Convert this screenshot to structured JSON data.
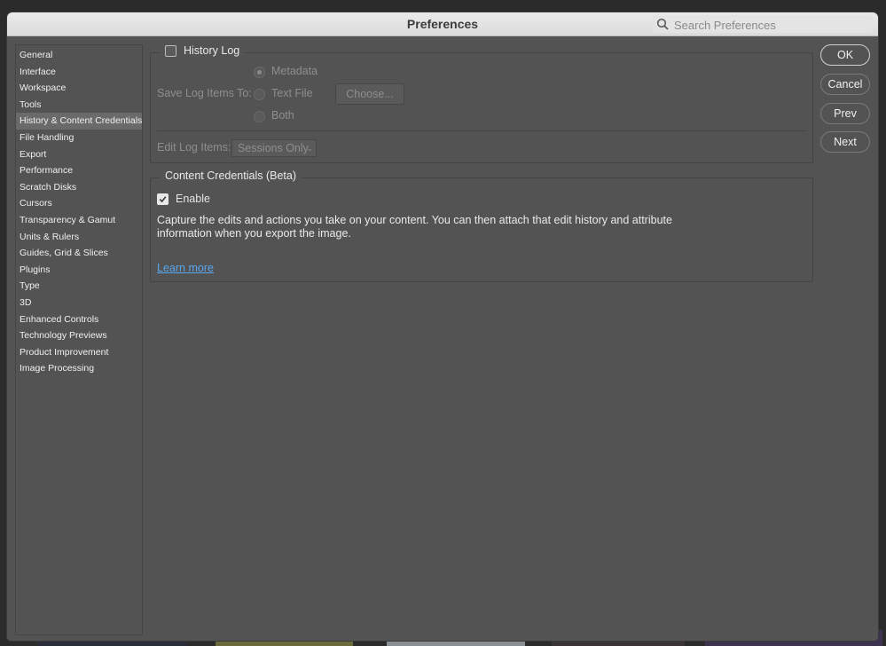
{
  "dialog": {
    "title": "Preferences",
    "search_placeholder": "Search Preferences"
  },
  "sidebar": {
    "items": [
      "General",
      "Interface",
      "Workspace",
      "Tools",
      "History & Content Credentials",
      "File Handling",
      "Export",
      "Performance",
      "Scratch Disks",
      "Cursors",
      "Transparency & Gamut",
      "Units & Rulers",
      "Guides, Grid & Slices",
      "Plugins",
      "Type",
      "3D",
      "Enhanced Controls",
      "Technology Previews",
      "Product Improvement",
      "Image Processing"
    ],
    "selected_index": 4
  },
  "history_log": {
    "label": "History Log",
    "checked": false,
    "save_label": "Save Log Items To:",
    "options": [
      "Metadata",
      "Text File",
      "Both"
    ],
    "selected_option": 0,
    "choose_label": "Choose...",
    "edit_label": "Edit Log Items:",
    "edit_value": "Sessions Only"
  },
  "content_credentials": {
    "title": "Content Credentials (Beta)",
    "enable_label": "Enable",
    "enable_checked": true,
    "description": "Capture the edits and actions you take on your content. You can then attach that edit history and attribute information when you export the image.",
    "learn_more": "Learn more"
  },
  "buttons": {
    "ok": "OK",
    "cancel": "Cancel",
    "prev": "Prev",
    "next": "Next"
  },
  "colors": {
    "dialog_bg": "#535353",
    "link": "#5aa6ee",
    "titlebar": "#e2e2e2"
  }
}
